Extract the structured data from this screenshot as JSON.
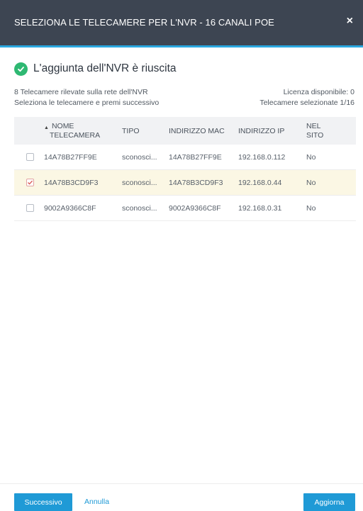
{
  "dialog": {
    "title": "SELEZIONA LE TELECAMERE PER L'NVR - 16 CANALI POE",
    "close_label": "×"
  },
  "status": {
    "message": "L'aggiunta dell'NVR è riuscita",
    "icon": "check-circle-icon",
    "color": "#2eb872"
  },
  "info": {
    "detected": "8 Telecamere rilevate sulla rete dell'NVR",
    "instruction": "Seleziona le telecamere e premi successivo",
    "license": "Licenza disponibile: 0",
    "selected": "Telecamere selezionate 1/16"
  },
  "table": {
    "headers": {
      "name_line1": "NOME",
      "name_line2": "TELECAMERA",
      "type": "TIPO",
      "mac": "INDIRIZZO MAC",
      "ip": "INDIRIZZO IP",
      "site_line1": "NEL",
      "site_line2": "SITO"
    },
    "rows": [
      {
        "checked": false,
        "name": "14A78B27FF9E",
        "type": "sconosci...",
        "mac": "14A78B27FF9E",
        "ip": "192.168.0.112",
        "site": "No"
      },
      {
        "checked": true,
        "name": "14A78B3CD9F3",
        "type": "sconosci...",
        "mac": "14A78B3CD9F3",
        "ip": "192.168.0.44",
        "site": "No"
      },
      {
        "checked": false,
        "name": "9002A9366C8F",
        "type": "sconosci...",
        "mac": "9002A9366C8F",
        "ip": "192.168.0.31",
        "site": "No"
      }
    ]
  },
  "footer": {
    "next_label": "Successivo",
    "cancel_label": "Annulla",
    "refresh_label": "Aggiorna"
  },
  "colors": {
    "titlebar": "#3d4552",
    "accent": "#1f9ad6",
    "selected_row": "#fbf7e4"
  }
}
